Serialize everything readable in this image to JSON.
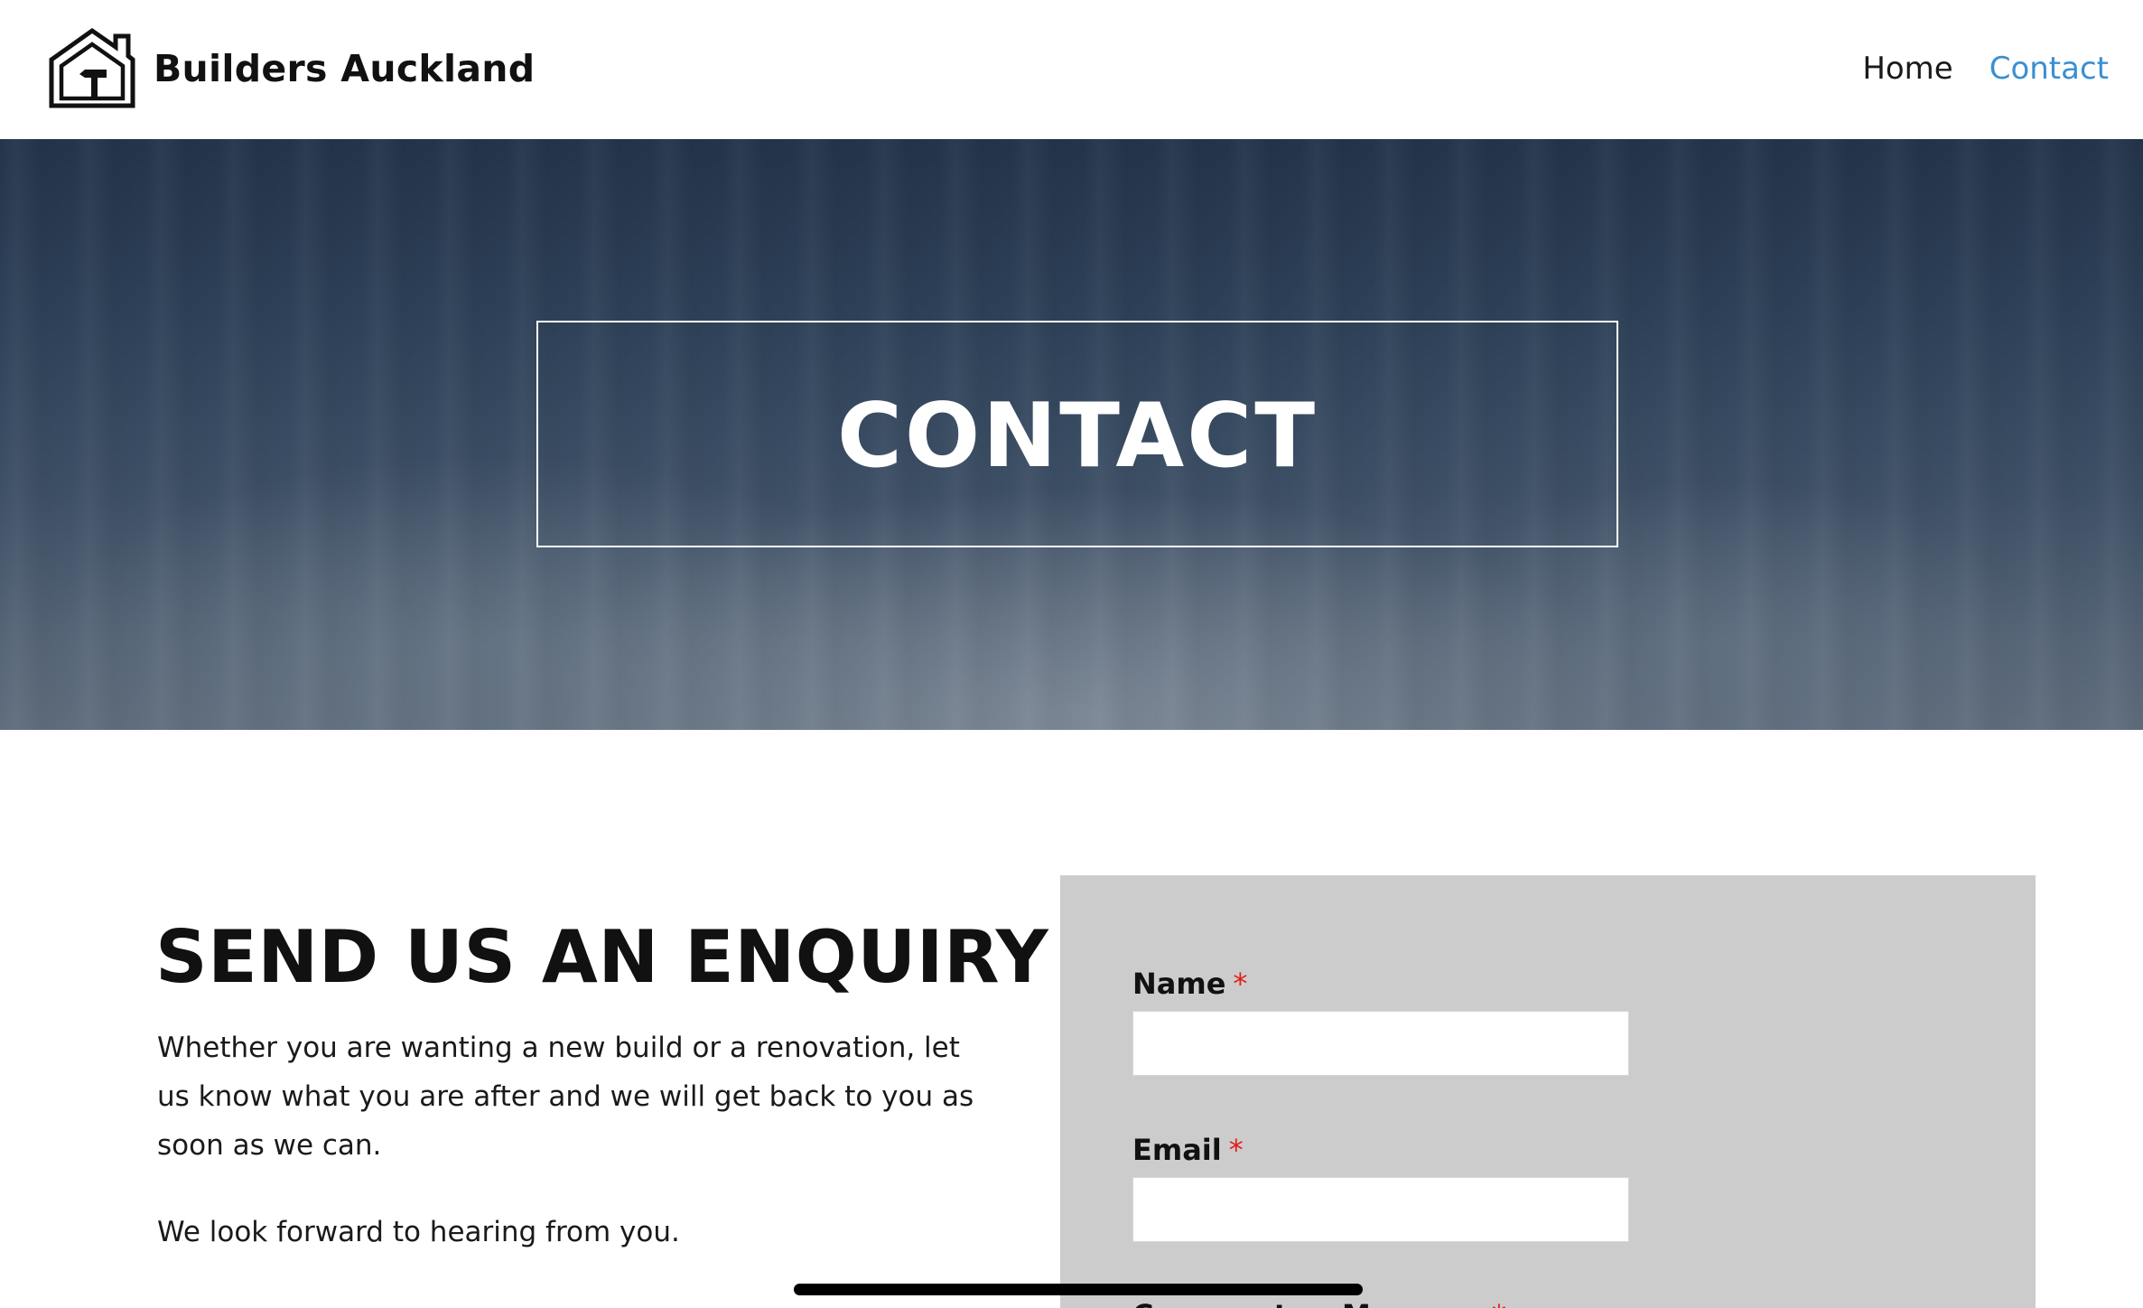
{
  "header": {
    "brand": "Builders Auckland",
    "logo_icon": "house-hammer-icon",
    "nav": [
      {
        "label": "Home",
        "active": false
      },
      {
        "label": "Contact",
        "active": true
      }
    ],
    "active_color": "#3b8fd0"
  },
  "hero": {
    "title": "CONTACT"
  },
  "enquiry": {
    "heading": "SEND US AN ENQUIRY",
    "paragraph": "Whether you are wanting a new build or a renovation, let us know what you are after and we will get back to you as soon as we can.",
    "paragraph_2": "We look forward to hearing from you."
  },
  "form": {
    "name_label": "Name",
    "name_required": "*",
    "name_value": "",
    "email_label": "Email",
    "email_required": "*",
    "email_value": "",
    "message_label": "Comment or Message",
    "message_required": "*",
    "required_color": "#e0201c"
  }
}
